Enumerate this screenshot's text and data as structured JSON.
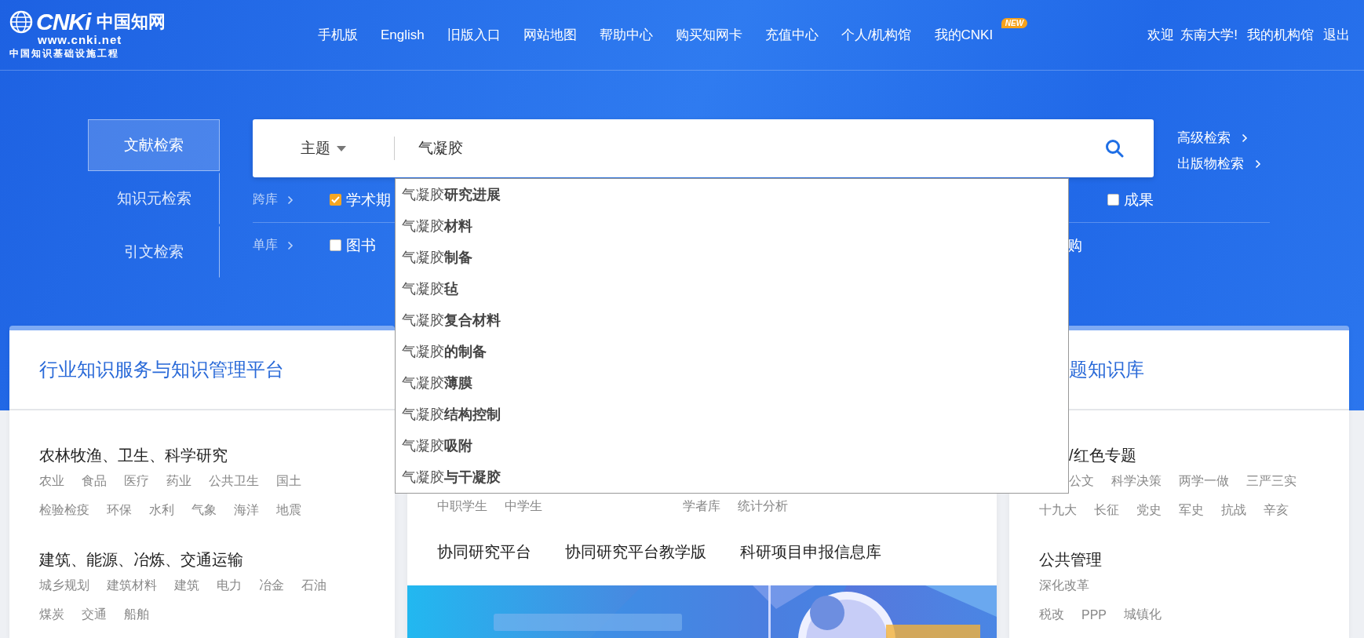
{
  "header": {
    "logo": {
      "mark": "CNKi",
      "name": "中国知网",
      "url": "www.cnki.net",
      "slogan": "中国知识基础设施工程"
    },
    "nav": [
      {
        "label": "手机版"
      },
      {
        "label": "English"
      },
      {
        "label": "旧版入口"
      },
      {
        "label": "网站地图"
      },
      {
        "label": "帮助中心"
      },
      {
        "label": "购买知网卡"
      },
      {
        "label": "充值中心"
      },
      {
        "label": "个人/机构馆"
      },
      {
        "label": "我的CNKI",
        "badge": "NEW"
      }
    ],
    "user": {
      "greeting": "欢迎",
      "org": "东南大学!",
      "links": [
        "我的机构馆",
        "退出"
      ]
    }
  },
  "search": {
    "tabs": [
      {
        "label": "文献检索",
        "selected": true
      },
      {
        "label": "知识元检索",
        "selected": false
      },
      {
        "label": "引文检索",
        "selected": false
      }
    ],
    "field": {
      "type": "主题",
      "value": "气凝胶"
    },
    "links": [
      "高级检索",
      "出版物检索"
    ],
    "rows": [
      {
        "label": "跨库",
        "options": [
          {
            "kind": "checkbox",
            "label": "学术期",
            "checked": true
          },
          {
            "kind": "checkbox",
            "label": "成果",
            "checked": false
          }
        ]
      },
      {
        "label": "单库",
        "options": [
          {
            "kind": "checkbox",
            "label": "图书",
            "checked": false
          },
          {
            "kind": "text",
            "label": "购"
          }
        ]
      }
    ],
    "suggestions": [
      "气凝胶**研究进展**",
      "气凝胶**材料**",
      "气凝胶**制备**",
      "气凝胶**毡**",
      "气凝胶**复合材料**",
      "气凝胶**的制备**",
      "气凝胶**薄膜**",
      "气凝胶**结构控制**",
      "气凝胶**吸附**",
      "气凝胶**与干凝胶**"
    ]
  },
  "cards": [
    {
      "kind": "industry",
      "title": "行业知识服务与知识管理平台",
      "sections": [
        {
          "title": "农林牧渔、卫生、科学研究",
          "tag_rows": [
            [
              "农业",
              "食品",
              "医疗",
              "药业",
              "公共卫生",
              "国土"
            ],
            [
              "检验检疫",
              "环保",
              "水利",
              "气象",
              "海洋",
              "地震"
            ]
          ]
        },
        {
          "title": "建筑、能源、冶炼、交通运输",
          "tag_rows": [
            [
              "城乡规划",
              "建筑材料",
              "建筑",
              "电力",
              "冶金",
              "石油"
            ],
            [
              "煤炭",
              "交通",
              "船舶"
            ]
          ]
        }
      ]
    },
    {
      "kind": "middle",
      "tag_groups": [
        [
          "中职学生",
          "中学生"
        ],
        [
          "学者库",
          "统计分析"
        ]
      ],
      "platforms": [
        "协同研究平台",
        "协同研究平台教学版",
        "科研项目申报信息库"
      ],
      "banner": {
        "kind": "picture"
      }
    },
    {
      "kind": "topic",
      "title": "题知识库",
      "sections": [
        {
          "title": "/红色专题",
          "tag_rows": [
            [
              "公文",
              "科学决策",
              "两学一做",
              "三严三实"
            ],
            [
              "十九大",
              "长征",
              "党史",
              "军史",
              "抗战",
              "辛亥"
            ]
          ]
        },
        {
          "title": "公共管理",
          "tag_rows": [
            [
              "深化改革"
            ],
            [
              "税改",
              "PPP",
              "城镇化"
            ]
          ]
        }
      ]
    }
  ]
}
